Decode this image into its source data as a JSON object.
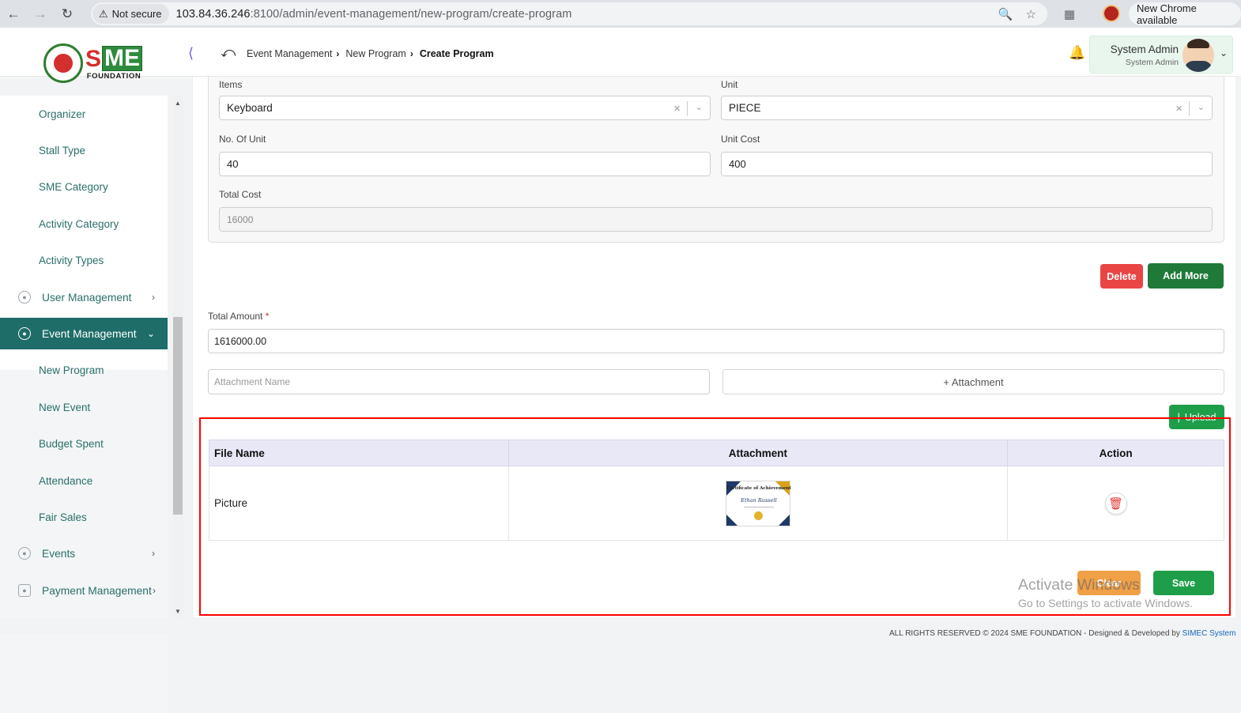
{
  "browser": {
    "security_label": "Not secure",
    "url_host": "103.84.36.246",
    "url_rest": ":8100/admin/event-management/new-program/create-program",
    "new_chrome_label": "New Chrome available"
  },
  "header": {
    "logo_text_s": "S",
    "logo_text_me": "ME",
    "logo_foundation": "FOUNDATION",
    "breadcrumb": [
      "Event Management",
      "New Program",
      "Create Program"
    ],
    "user_name": "System Admin",
    "user_role": "System Admin"
  },
  "sidebar": {
    "sub_items_top": [
      "Organizer",
      "Stall Type",
      "SME Category",
      "Activity Category",
      "Activity Types"
    ],
    "user_management": "User Management",
    "event_management": "Event Management",
    "sub_items_event": [
      "New Program",
      "New Event",
      "Budget Spent",
      "Attendance",
      "Fair Sales"
    ],
    "events": "Events",
    "payment_management": "Payment Management"
  },
  "form": {
    "items_label": "Items",
    "items_value": "Keyboard",
    "unit_label": "Unit",
    "unit_value": "PIECE",
    "no_of_unit_label": "No. Of Unit",
    "no_of_unit_value": "40",
    "unit_cost_label": "Unit Cost",
    "unit_cost_value": "400",
    "total_cost_label": "Total Cost",
    "total_cost_value": "16000",
    "delete_label": "Delete",
    "add_more_label": "Add More",
    "total_amount_label": "Total Amount",
    "total_amount_required": "*",
    "total_amount_value": "1616000.00",
    "attachment_name_placeholder": "Attachment Name",
    "attachment_button": "+ Attachment",
    "upload_label": "Upload",
    "clear_label": "Clear",
    "save_label": "Save"
  },
  "table": {
    "headers": [
      "File Name",
      "Attachment",
      "Action"
    ],
    "rows": [
      {
        "file_name": "Picture",
        "cert_title": "Certificate of Achievement",
        "cert_name": "Ethan Russell"
      }
    ]
  },
  "watermark": {
    "line1": "Activate Windows",
    "line2": "Go to Settings to activate Windows."
  },
  "footer": {
    "text": "ALL RIGHTS RESERVED © 2024 SME FOUNDATION - Designed & Developed by ",
    "link": "SIMEC System"
  },
  "colors": {
    "primary": "#1f6d69",
    "success": "#1e9e49",
    "danger": "#e94545",
    "warning": "#f0a046",
    "highlight": "#ff0000"
  }
}
